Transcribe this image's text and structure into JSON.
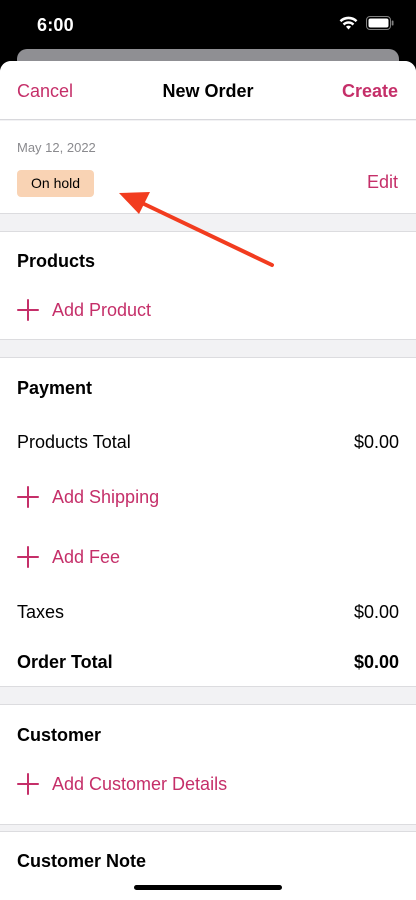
{
  "status_bar": {
    "time": "6:00",
    "icons": [
      "wifi-icon",
      "battery-icon"
    ]
  },
  "nav": {
    "cancel": "Cancel",
    "title": "New Order",
    "create": "Create"
  },
  "order": {
    "date": "May 12, 2022",
    "status": "On hold",
    "edit": "Edit"
  },
  "products": {
    "title": "Products",
    "add_label": "Add Product"
  },
  "payment": {
    "title": "Payment",
    "products_total_label": "Products Total",
    "products_total_value": "$0.00",
    "add_shipping": "Add Shipping",
    "add_fee": "Add Fee",
    "taxes_label": "Taxes",
    "taxes_value": "$0.00",
    "order_total_label": "Order Total",
    "order_total_value": "$0.00"
  },
  "customer": {
    "title": "Customer",
    "add_label": "Add Customer Details"
  },
  "customer_note": {
    "title": "Customer Note"
  },
  "colors": {
    "accent": "#c52f69",
    "status_badge": "#f9d3b4",
    "annotation_arrow": "#f23c1f"
  }
}
